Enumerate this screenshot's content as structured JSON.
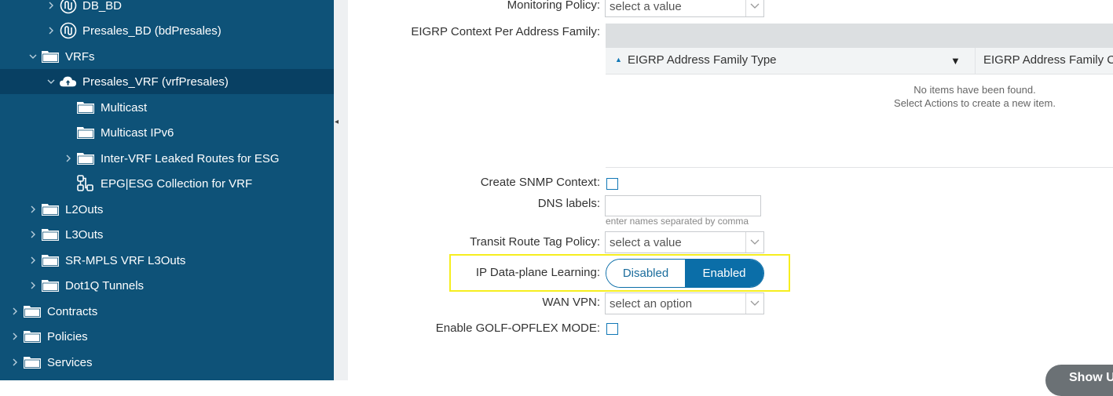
{
  "sidebar": {
    "items": [
      {
        "label": "DB_BD",
        "icon": "bridge-domain-icon"
      },
      {
        "label": "Presales_BD (bdPresales)",
        "icon": "bridge-domain-icon"
      },
      {
        "label": "VRFs",
        "icon": "folder-icon"
      },
      {
        "label": "Presales_VRF (vrfPresales)",
        "icon": "cloud-icon"
      },
      {
        "label": "Multicast",
        "icon": "folder-icon"
      },
      {
        "label": "Multicast IPv6",
        "icon": "folder-icon"
      },
      {
        "label": "Inter-VRF Leaked Routes for ESG",
        "icon": "folder-icon"
      },
      {
        "label": "EPG|ESG Collection for VRF",
        "icon": "collection-icon"
      },
      {
        "label": "L2Outs",
        "icon": "folder-icon"
      },
      {
        "label": "L3Outs",
        "icon": "folder-icon"
      },
      {
        "label": "SR-MPLS VRF L3Outs",
        "icon": "folder-icon"
      },
      {
        "label": "Dot1Q Tunnels",
        "icon": "folder-icon"
      },
      {
        "label": "Contracts",
        "icon": "folder-icon"
      },
      {
        "label": "Policies",
        "icon": "folder-icon"
      },
      {
        "label": "Services",
        "icon": "folder-icon"
      }
    ]
  },
  "form": {
    "monitoring_policy": {
      "label": "Monitoring Policy:",
      "value": "select a value"
    },
    "eigrp_context": {
      "label": "EIGRP Context Per Address Family:",
      "columns": [
        "EIGRP Address Family Type",
        "EIGRP Address Family C"
      ],
      "empty_line1": "No items have been found.",
      "empty_line2": "Select Actions to create a new item."
    },
    "snmp_context": {
      "label": "Create SNMP Context:"
    },
    "dns_labels": {
      "label": "DNS labels:",
      "hint": "enter names separated by comma"
    },
    "transit_route_tag": {
      "label": "Transit Route Tag Policy:",
      "value": "select a value"
    },
    "ip_dataplane": {
      "label": "IP Data-plane Learning:",
      "option_off": "Disabled",
      "option_on": "Enabled",
      "selected": "Enabled"
    },
    "wan_vpn": {
      "label": "WAN VPN:",
      "value": "select an option"
    },
    "golf_opflex": {
      "label": "Enable GOLF-OPFLEX MODE:"
    }
  },
  "footer": {
    "show_button": "Show U"
  },
  "colors": {
    "sidebar_bg": "#0e5278",
    "accent": "#0b6ea8",
    "highlight": "#f6ee1f"
  }
}
